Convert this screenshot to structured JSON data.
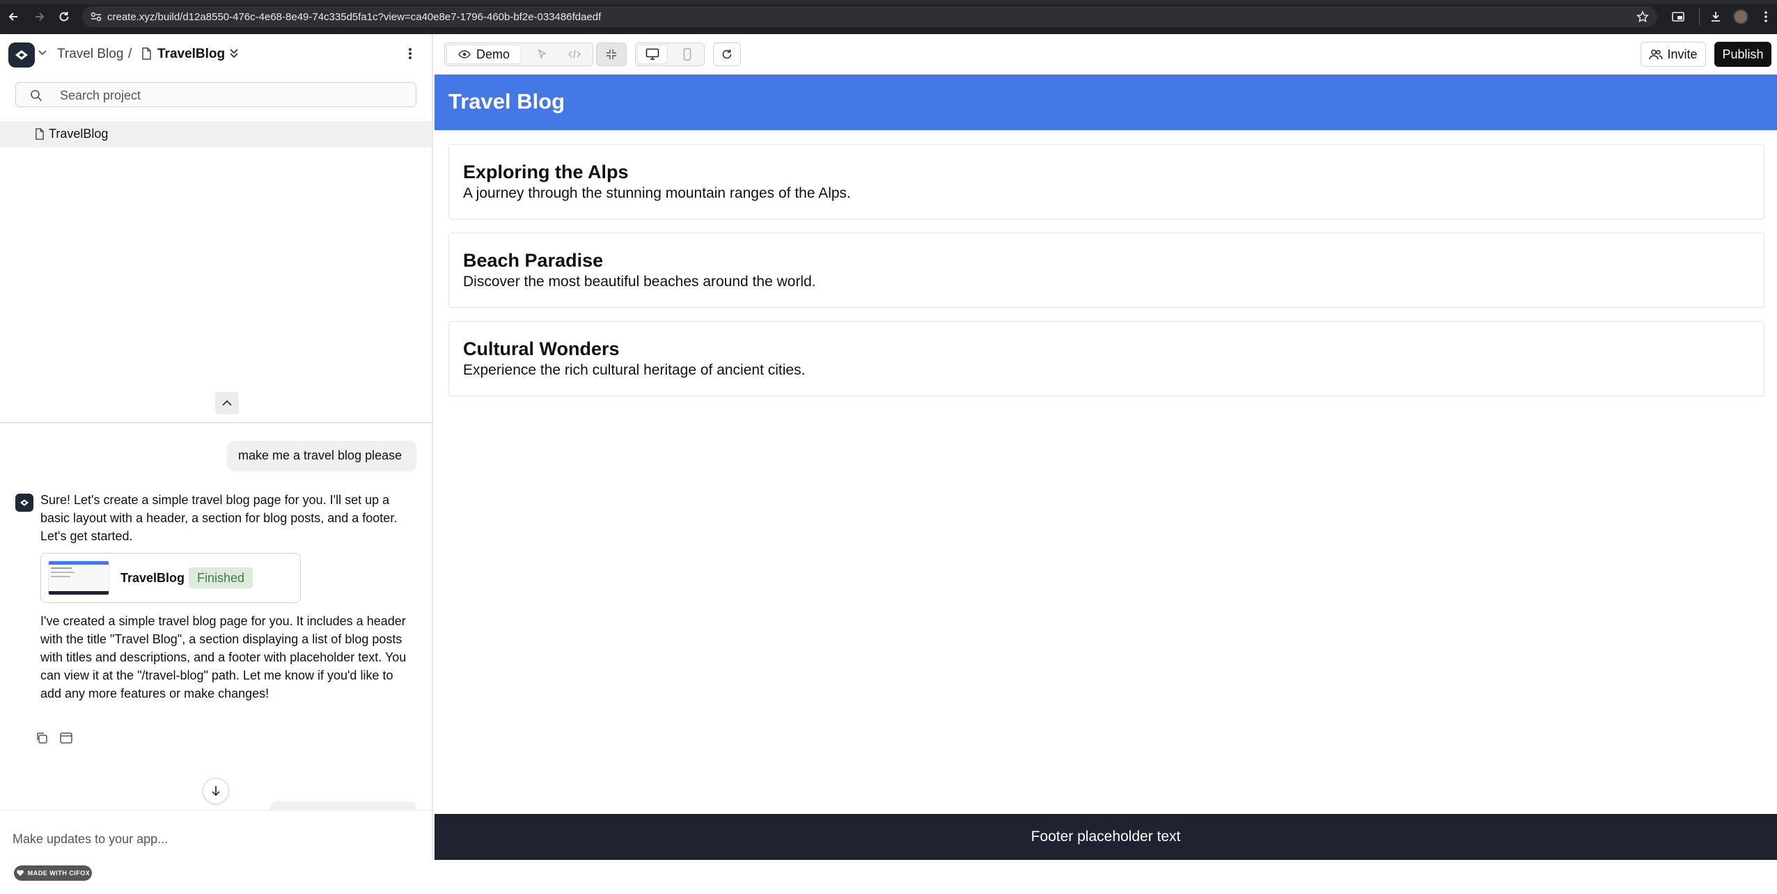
{
  "browser": {
    "url": "create.xyz/build/d12a8550-476c-4e68-8e49-74c335d5fa1c?view=ca40e8e7-1796-460b-bf2e-033486fdaedf"
  },
  "sidebar": {
    "project_name": "Travel Blog",
    "separator": "/",
    "page_name": "TravelBlog",
    "search_placeholder": "Search project",
    "files": [
      {
        "label": "TravelBlog"
      }
    ]
  },
  "chat": {
    "user_message": "make me a travel blog please",
    "bot_intro": "Sure! Let's create a simple travel blog page for you. I'll set up a basic layout with a header, a section for blog posts, and a footer. Let's get started.",
    "artifact": {
      "name": "TravelBlog",
      "status": "Finished"
    },
    "bot_summary": "I've created a simple travel blog page for you. It includes a header with the title \"Travel Blog\", a section displaying a list of blog posts with titles and descriptions, and a footer with placeholder text. You can view it at the \"/travel-blog\" path. Let me know if you'd like to add any more features or make changes!",
    "composer_placeholder": "Make updates to your app...",
    "made_with": "MADE WITH CIFOX"
  },
  "toolbar": {
    "demo_label": "Demo",
    "invite_label": "Invite",
    "publish_label": "Publish"
  },
  "preview": {
    "site_title": "Travel Blog",
    "posts": [
      {
        "title": "Exploring the Alps",
        "description": "A journey through the stunning mountain ranges of the Alps."
      },
      {
        "title": "Beach Paradise",
        "description": "Discover the most beautiful beaches around the world."
      },
      {
        "title": "Cultural Wonders",
        "description": "Experience the rich cultural heritage of ancient cities."
      }
    ],
    "footer_text": "Footer placeholder text"
  },
  "colors": {
    "header_blue": "#4478e6",
    "footer_dark": "#1f2230",
    "publish_black": "#111111",
    "status_green_bg": "#dcebdc"
  }
}
